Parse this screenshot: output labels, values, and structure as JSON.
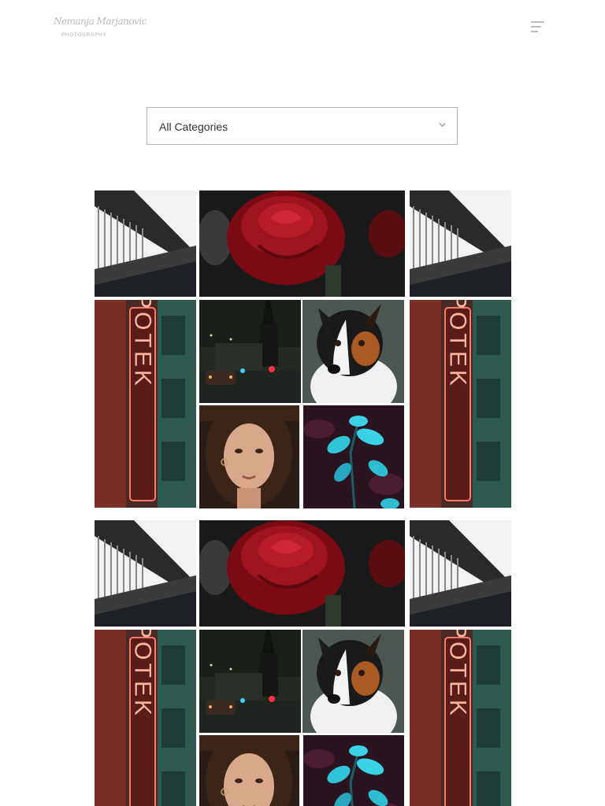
{
  "header": {
    "logo_script": "Nemanja Marjanovic",
    "logo_sub": "PHOTOGRAPHY",
    "menu_icon": "hamburger-menu-icon"
  },
  "filter": {
    "selected": "All Categories",
    "icon": "chevron-down-icon"
  },
  "sign_text": "APOTEK",
  "gallery_groups": [
    {
      "tiles": [
        "roof-architecture-photo",
        "red-rose-photo",
        "roof-architecture-photo",
        "apotek-neon-sign-photo",
        "night-church-street-photo",
        "dog-portrait-photo",
        "woman-portrait-photo",
        "cyan-leaves-photo",
        "apotek-neon-sign-photo"
      ]
    },
    {
      "tiles": [
        "roof-architecture-photo",
        "red-rose-photo",
        "roof-architecture-photo",
        "apotek-neon-sign-photo",
        "night-church-street-photo",
        "dog-portrait-photo",
        "woman-portrait-photo",
        "cyan-leaves-photo",
        "apotek-neon-sign-photo"
      ]
    }
  ]
}
